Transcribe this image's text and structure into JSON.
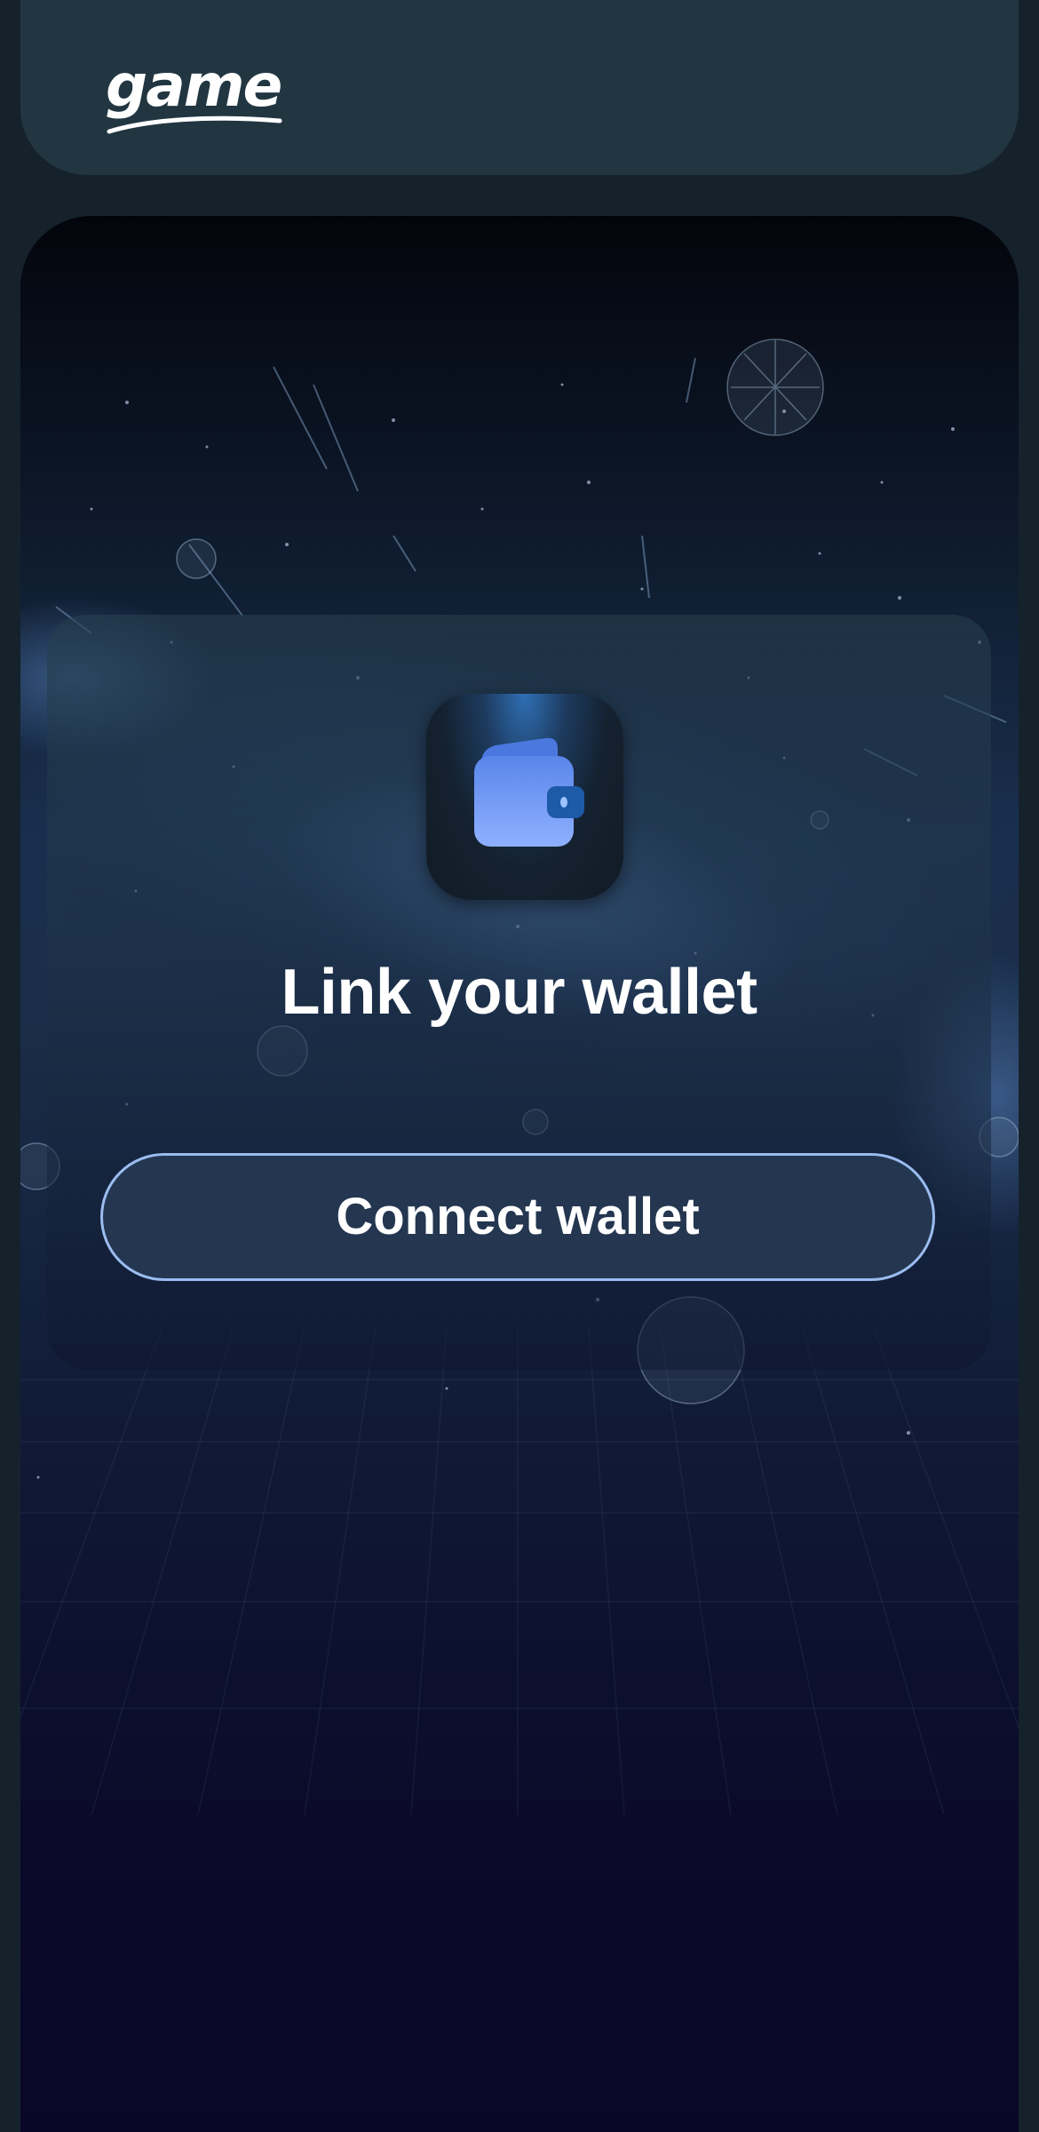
{
  "header": {
    "logo_text": "game"
  },
  "wallet_panel": {
    "icon": "wallet-icon",
    "title": "Link your wallet",
    "connect_button_label": "Connect wallet"
  },
  "colors": {
    "page_background": "#15222b",
    "header_background": "#223642",
    "button_border": "#9bbcf0",
    "wallet_icon_blue": "#6a95f2"
  }
}
